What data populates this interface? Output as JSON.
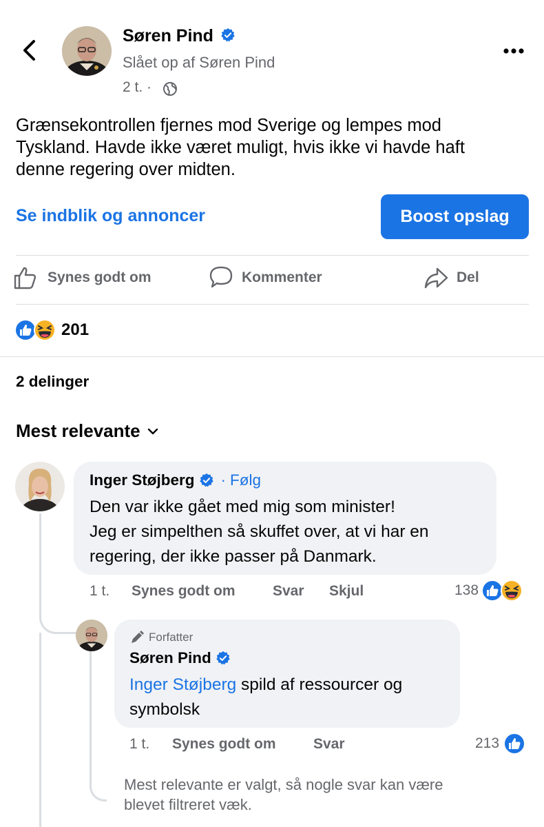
{
  "header": {
    "author_name": "Søren Pind",
    "posted_by": "Slået op af Søren Pind",
    "time": "2 t.",
    "separator": "·"
  },
  "post": {
    "text_line1": "Grænsekontrollen fjernes mod Sverige og lempes mod",
    "text_line2": "Tyskland. Havde ikke været muligt, hvis ikke vi havde haft",
    "text_line3": "denne regering over midten."
  },
  "insights": {
    "link_label": "Se indblik og annoncer",
    "boost_label": "Boost opslag"
  },
  "actions": {
    "like": "Synes godt om",
    "comment": "Kommenter",
    "share": "Del"
  },
  "stats": {
    "reactions_count": "201",
    "shares": "2 delinger"
  },
  "sort": {
    "label": "Mest relevante"
  },
  "comment1": {
    "author": "Inger Støjberg",
    "dot": "·",
    "follow": "Følg",
    "line1": "Den var ikke gået med mig som minister!",
    "line2": "Jeg er simpelthen så skuffet over, at vi har en",
    "line3": "regering, der ikke passer på Danmark.",
    "time": "1 t.",
    "like": "Synes godt om",
    "reply": "Svar",
    "hide": "Skjul",
    "reaction_count": "138"
  },
  "reply1": {
    "badge": "Forfatter",
    "author": "Søren Pind",
    "mention": "Inger Støjberg",
    "text_rest": " spild af ressourcer og",
    "line2": "symbolsk",
    "time": "1 t.",
    "like": "Synes godt om",
    "reply": "Svar",
    "reaction_count": "213"
  },
  "filter_notice": {
    "line1": "Mest relevante er valgt, så nogle svar kan være",
    "line2": "blevet filtreret væk."
  },
  "colors": {
    "facebook_blue": "#1b74e4",
    "bubble_grey": "#f0f2f5",
    "secondary_text": "#65676b",
    "haha_yellow": "#f7b125"
  }
}
